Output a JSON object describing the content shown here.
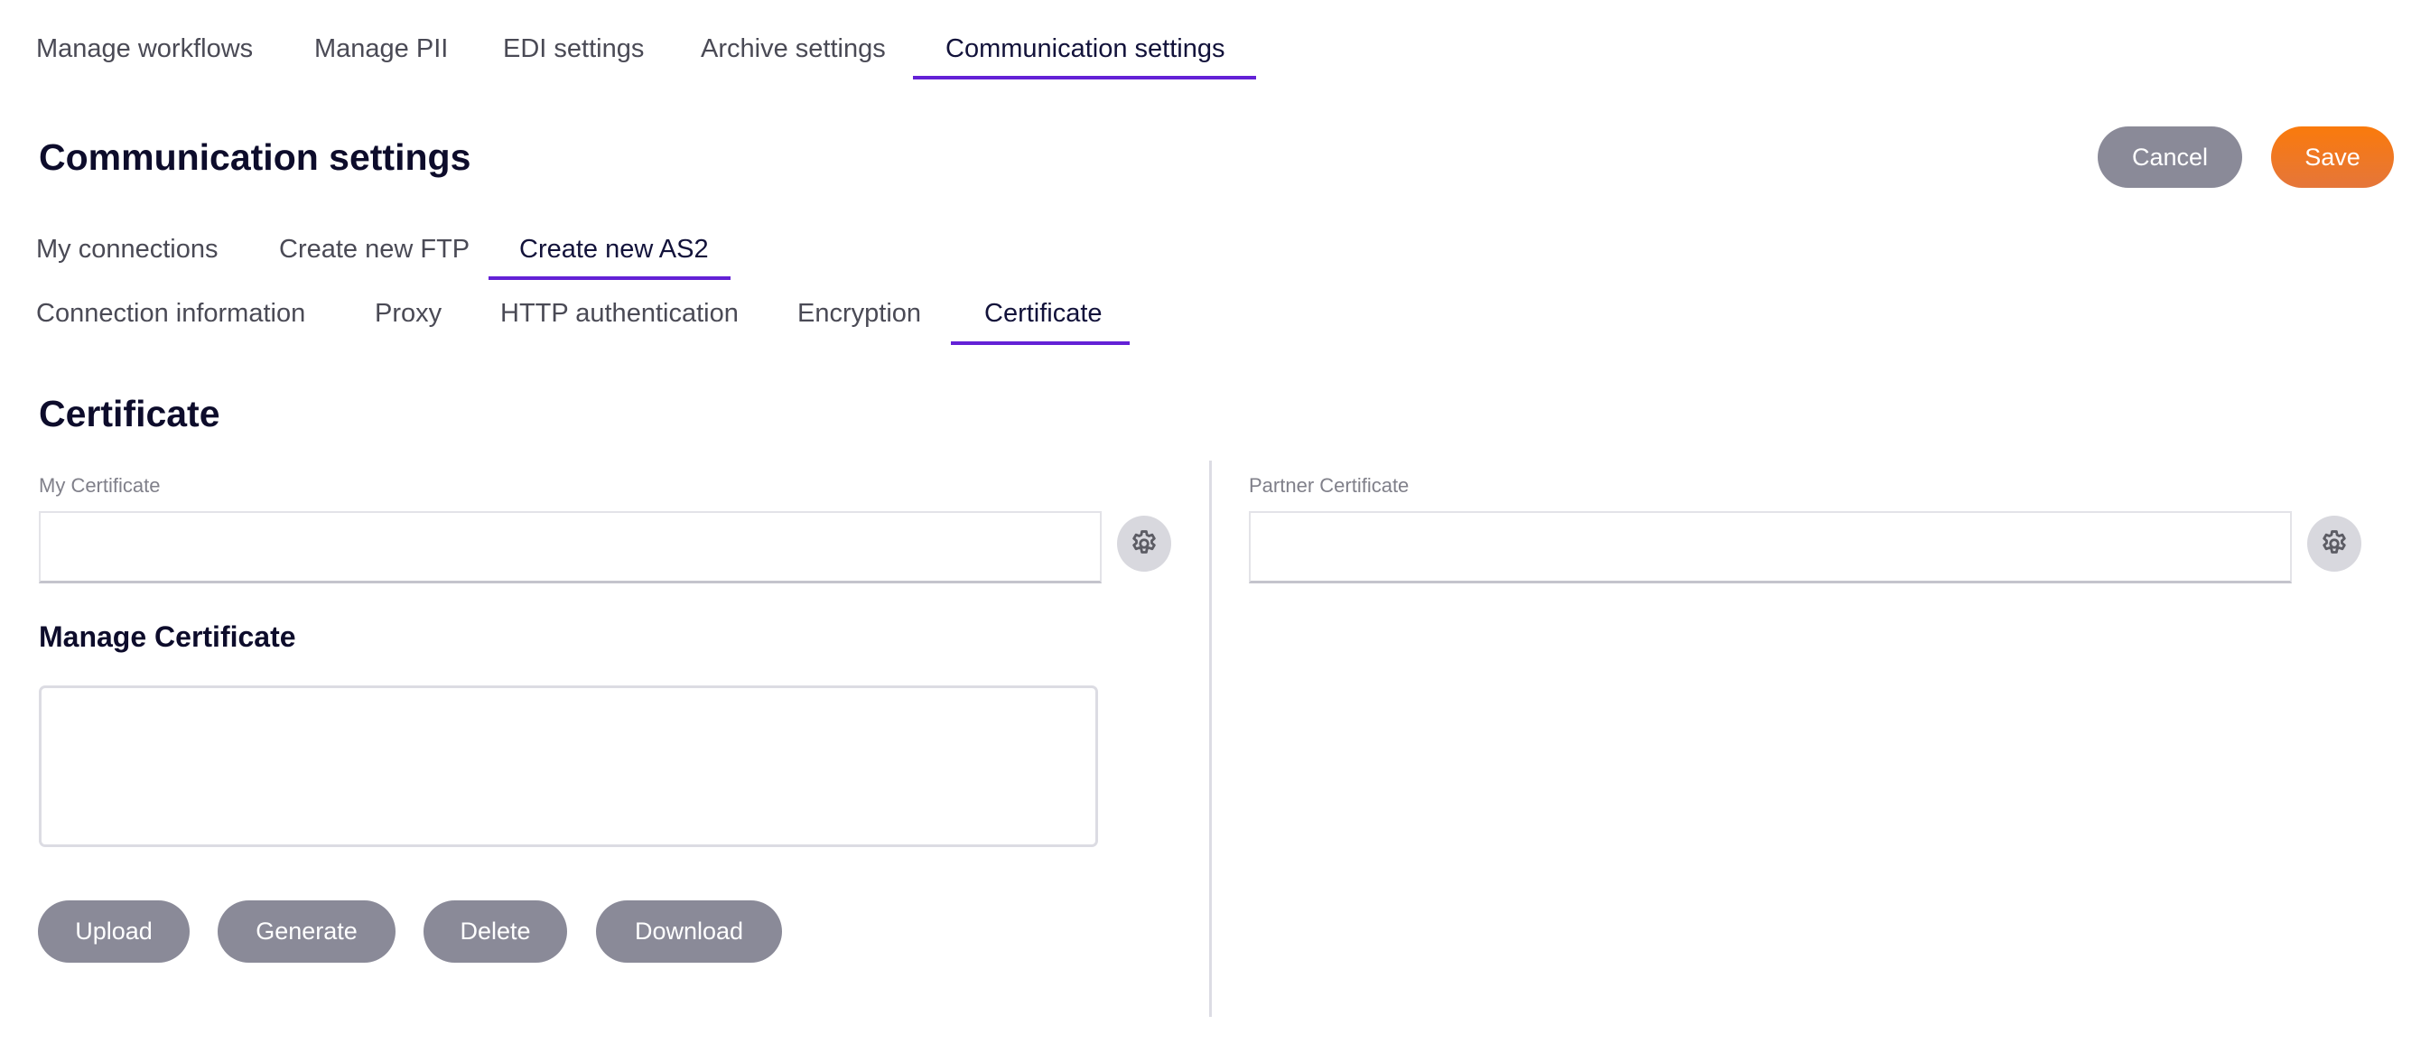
{
  "top_tabs": [
    {
      "label": "Manage workflows",
      "active": false
    },
    {
      "label": "Manage PII",
      "active": false
    },
    {
      "label": "EDI settings",
      "active": false
    },
    {
      "label": "Archive settings",
      "active": false
    },
    {
      "label": "Communication settings",
      "active": true
    }
  ],
  "page": {
    "title": "Communication settings",
    "cancel_label": "Cancel",
    "save_label": "Save"
  },
  "connection_tabs": [
    {
      "label": "My connections",
      "active": false
    },
    {
      "label": "Create new FTP",
      "active": false
    },
    {
      "label": "Create new AS2",
      "active": true
    }
  ],
  "as2_tabs": [
    {
      "label": "Connection information",
      "active": false
    },
    {
      "label": "Proxy",
      "active": false
    },
    {
      "label": "HTTP authentication",
      "active": false
    },
    {
      "label": "Encryption",
      "active": false
    },
    {
      "label": "Certificate",
      "active": true
    }
  ],
  "certificate": {
    "section_title": "Certificate",
    "my_certificate": {
      "label": "My Certificate",
      "value": "",
      "icon": "gear-icon"
    },
    "partner_certificate": {
      "label": "Partner Certificate",
      "value": "",
      "icon": "gear-icon"
    },
    "manage": {
      "title": "Manage Certificate",
      "textarea_value": "",
      "buttons": [
        "Upload",
        "Generate",
        "Delete",
        "Download"
      ]
    }
  },
  "colors": {
    "accent": "#6321d6",
    "save": "#f57a1c",
    "secondary_button": "#8a8a98",
    "heading": "#0d0c2b"
  }
}
